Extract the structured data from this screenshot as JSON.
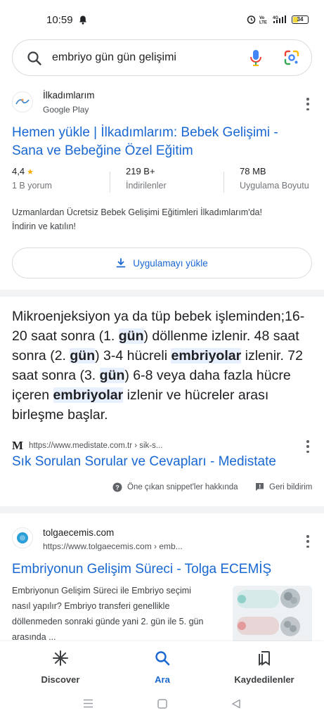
{
  "status_bar": {
    "time": "10:59",
    "battery": "34",
    "network_label": "4G",
    "icons": [
      "bell-icon",
      "alarm-icon",
      "vo-lte-icon",
      "signal-icon",
      "battery-icon"
    ]
  },
  "search": {
    "query": "embriyo gün gün gelişimi",
    "icons": [
      "search-icon",
      "mic-icon",
      "google-lens-icon"
    ]
  },
  "app_result": {
    "site_name": "İlkadımlarım",
    "site_source": "Google Play",
    "title_line1": "Hemen yükle | İlkadımlarım: Bebek Gelişimi -",
    "title_line2": "Sana ve Bebeğine Özel Eğitim",
    "rating": "4,4",
    "rating_count": "1 B yorum",
    "downloads": "219 B+",
    "downloads_label": "İndirilenler",
    "size": "78 MB",
    "size_label": "Uygulama Boyutu",
    "description_line1": "Uzmanlardan Ücretsiz Bebek Gelişimi Eğitimleri İlkadımlarım'da!",
    "description_line2": "İndirin ve katılın!",
    "install_label": "Uygulamayı yükle"
  },
  "featured_snippet": {
    "segments": [
      {
        "text": "Mikroenjeksiyon ya da tüp bebek işleminden;16-20 saat sonra (1. ",
        "hl": false
      },
      {
        "text": "gün",
        "hl": true
      },
      {
        "text": ") döllenme izlenir. 48 saat sonra (2. ",
        "hl": false
      },
      {
        "text": "gün",
        "hl": true
      },
      {
        "text": ") 3-4 hücreli ",
        "hl": false
      },
      {
        "text": "embriyolar",
        "hl": true
      },
      {
        "text": " izlenir. 72 saat sonra (3. ",
        "hl": false
      },
      {
        "text": "gün",
        "hl": true
      },
      {
        "text": ") 6-8 veya daha fazla hücre içeren ",
        "hl": false
      },
      {
        "text": "embriyolar",
        "hl": true
      },
      {
        "text": " izlenir ve hücreler arası birleşme başlar.",
        "hl": false
      }
    ],
    "source_url": "https://www.medistate.com.tr › sik-s...",
    "title": "Sık Sorulan Sorular ve Cevapları - Medistate",
    "about_label": "Öne çıkan snippet'ler hakkında",
    "feedback_label": "Geri bildirim"
  },
  "tolga_result": {
    "site_name": "tolgaecemis.com",
    "url": "https://www.tolgaecemis.com › emb...",
    "title": "Embriyonun Gelişim Süreci - Tolga ECEMİŞ",
    "description_line1": "Embriyonun Gelişim Süreci ile Embriyo seçimi",
    "description_line2": "nasıl yapılır? Embriyo transferi genellikle",
    "description_line3": "döllenmeden sonraki günde yani 2. gün ile 5. gün",
    "description_line4": "arasında ..."
  },
  "bottom_nav": {
    "discover": "Discover",
    "search": "Ara",
    "saved": "Kaydedilenler",
    "active": "search"
  },
  "colors": {
    "link_blue": "#1967d2",
    "highlight": "#e8f0fe",
    "star": "#f9ab00",
    "battery": "#f1d83a"
  }
}
